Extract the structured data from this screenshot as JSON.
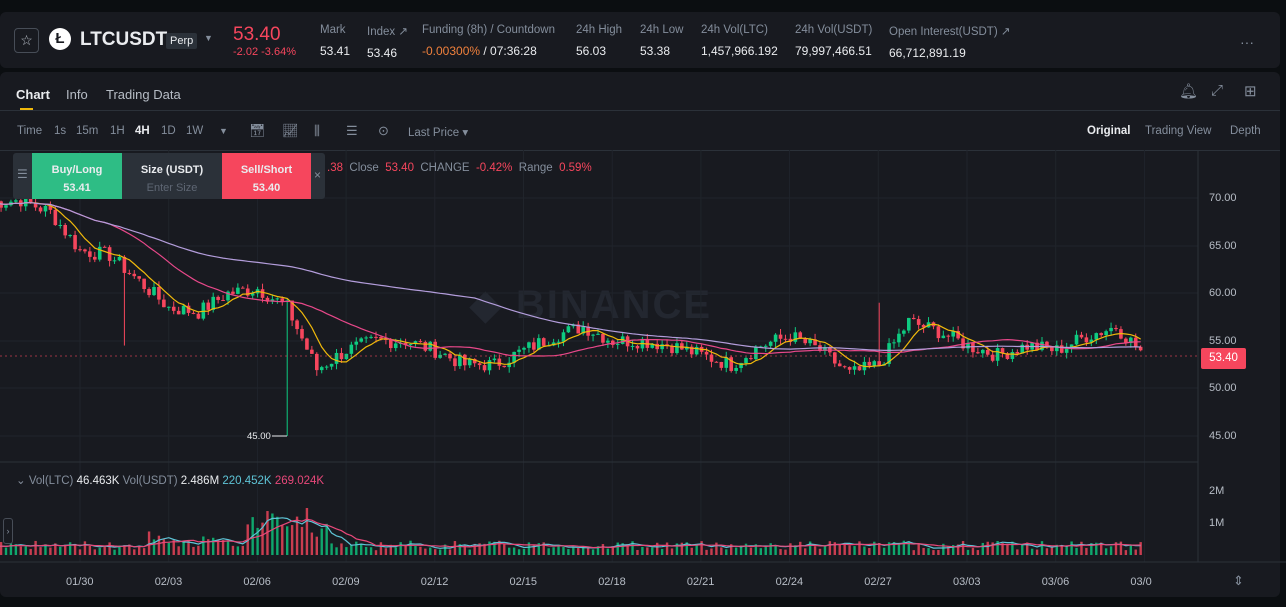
{
  "header": {
    "symbol": "LTCUSDT",
    "contract_type": "Perp",
    "last_price": "53.40",
    "change": "-2.02",
    "change_pct": "-3.64%",
    "stats": [
      {
        "label": "Mark",
        "value": "53.41"
      },
      {
        "label": "Index ↗",
        "value": "53.46"
      },
      {
        "label": "Funding (8h) / Countdown",
        "value": "-0.00300%",
        "value2": " / 07:36:28"
      },
      {
        "label": "24h High",
        "value": "56.03"
      },
      {
        "label": "24h Low",
        "value": "53.38"
      },
      {
        "label": "24h Vol(LTC)",
        "value": "1,457,966.192"
      },
      {
        "label": "24h Vol(USDT)",
        "value": "79,997,466.51"
      },
      {
        "label": "Open Interest(USDT) ↗",
        "value": "66,712,891.19"
      }
    ],
    "more": "···"
  },
  "tabs": [
    "Chart",
    "Info",
    "Trading Data"
  ],
  "toolbar": {
    "intervals": [
      "Time",
      "1s",
      "15m",
      "1H",
      "4H",
      "1D",
      "1W"
    ],
    "active_interval": "4H",
    "price_type": "Last Price ▾",
    "views": [
      "Original",
      "Trading View",
      "Depth"
    ],
    "active_view": "Original"
  },
  "trade_widget": {
    "buy_label": "Buy/Long",
    "buy_price": "53.41",
    "size_label": "Size (USDT)",
    "size_placeholder": "Enter Size",
    "sell_label": "Sell/Short",
    "sell_price": "53.40"
  },
  "ohlc": {
    "partial": ".38",
    "close_label": "Close",
    "close": "53.40",
    "change_label": "CHANGE",
    "change": "-0.42%",
    "range_label": "Range",
    "range": "0.59%"
  },
  "watermark": "BINANCE",
  "volume_legend": {
    "vol_ltc_label": "Vol(LTC)",
    "vol_ltc": "46.463K",
    "vol_usdt_label": "Vol(USDT)",
    "vol_usdt": "2.486M",
    "ma1": "220.452K",
    "ma2": "269.024K"
  },
  "colors": {
    "up": "#0ecb81",
    "down": "#f6465d",
    "ma7": "#f0b90b",
    "ma25": "#e8488a",
    "ma99": "#b39ddb",
    "vol_ma1": "#5ec4d6",
    "vol_ma2": "#e8487a"
  },
  "chart_data": {
    "type": "candlestick",
    "interval": "4H",
    "price_ticks": [
      "70.00",
      "65.00",
      "60.00",
      "55.00",
      "50.00",
      "45.00"
    ],
    "ylim": [
      45,
      70
    ],
    "volume_ticks": [
      "2M",
      "1M"
    ],
    "x_ticks": [
      "01/30",
      "02/03",
      "02/06",
      "02/09",
      "02/12",
      "02/15",
      "02/18",
      "02/21",
      "02/24",
      "02/27",
      "03/03",
      "03/06",
      "03/0"
    ],
    "low_marker": "45.00",
    "last_price_tag": "53.40",
    "price_path": [
      [
        "01/27",
        69.5
      ],
      [
        "01/28",
        69.8
      ],
      [
        "01/29",
        68.5
      ],
      [
        "01/30",
        64.5
      ],
      [
        "01/31",
        64
      ],
      [
        "02/01",
        58.5
      ],
      [
        "02/02",
        58
      ],
      [
        "02/03",
        60
      ],
      [
        "02/04",
        60.5
      ],
      [
        "02/05",
        58.5
      ],
      [
        "02/06",
        52
      ],
      [
        "02/07",
        54
      ],
      [
        "02/08",
        55
      ],
      [
        "02/09",
        55
      ],
      [
        "02/10",
        54
      ],
      [
        "02/11",
        52.5
      ],
      [
        "02/12",
        52.5
      ],
      [
        "02/13",
        54
      ],
      [
        "02/14",
        55.5
      ],
      [
        "02/15",
        56.5
      ],
      [
        "02/16",
        55
      ],
      [
        "02/17",
        55
      ],
      [
        "02/18",
        54.5
      ],
      [
        "02/19",
        53.5
      ],
      [
        "02/20",
        52.5
      ],
      [
        "02/21",
        54.5
      ],
      [
        "02/22",
        55.5
      ],
      [
        "02/23",
        54
      ],
      [
        "02/24",
        51.5
      ],
      [
        "02/25",
        52.5
      ],
      [
        "02/26",
        57
      ],
      [
        "02/27",
        56
      ],
      [
        "02/28",
        54.5
      ],
      [
        "03/01",
        53.5
      ],
      [
        "03/02",
        54.5
      ],
      [
        "03/03",
        54
      ],
      [
        "03/04",
        55.5
      ],
      [
        "03/05",
        56.5
      ],
      [
        "03/06",
        53.4
      ]
    ]
  }
}
